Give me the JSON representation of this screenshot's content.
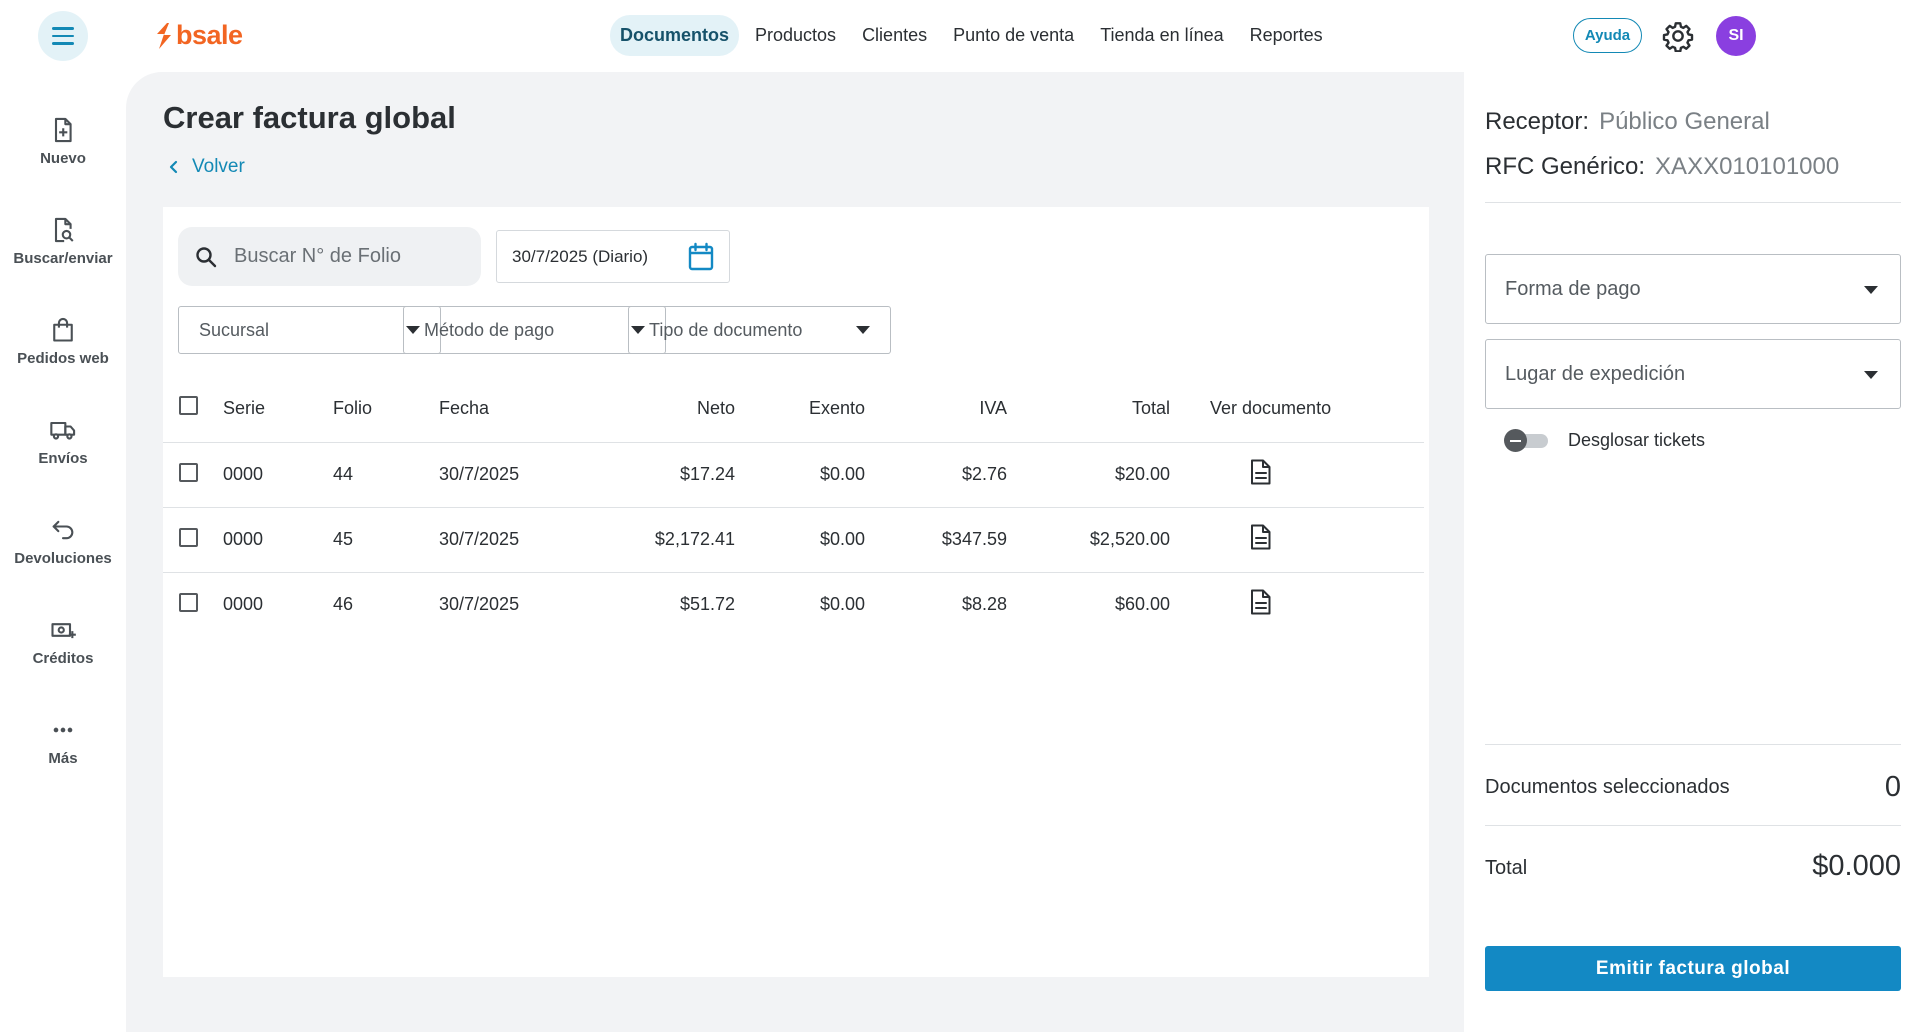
{
  "brand": {
    "name": "bsale",
    "color": "#f26522"
  },
  "nav": {
    "items": [
      {
        "label": "Documentos",
        "active": true
      },
      {
        "label": "Productos"
      },
      {
        "label": "Clientes"
      },
      {
        "label": "Punto de venta"
      },
      {
        "label": "Tienda en línea"
      },
      {
        "label": "Reportes"
      }
    ],
    "help_label": "Ayuda",
    "avatar_initials": "SI"
  },
  "sidebar": {
    "items": [
      {
        "label": "Nuevo",
        "icon": "file-plus-icon"
      },
      {
        "label": "Buscar/enviar",
        "icon": "file-search-icon"
      },
      {
        "label": "Pedidos web",
        "icon": "shopping-bag-icon"
      },
      {
        "label": "Envíos",
        "icon": "truck-icon"
      },
      {
        "label": "Devoluciones",
        "icon": "return-arrow-icon"
      },
      {
        "label": "Créditos",
        "icon": "money-plus-icon"
      },
      {
        "label": "Más",
        "icon": "more-dots-icon"
      }
    ]
  },
  "page": {
    "title": "Crear factura global",
    "back_label": "Volver"
  },
  "filters": {
    "search_placeholder": "Buscar N° de Folio",
    "date_value": "30/7/2025 (Diario)",
    "sucursal": "Sucursal",
    "metodo_pago": "Método de pago",
    "tipo_documento": "Tipo de documento"
  },
  "table": {
    "headers": {
      "serie": "Serie",
      "folio": "Folio",
      "fecha": "Fecha",
      "neto": "Neto",
      "exento": "Exento",
      "iva": "IVA",
      "total": "Total",
      "ver": "Ver documento"
    },
    "rows": [
      {
        "serie": "0000",
        "folio": "44",
        "fecha": "30/7/2025",
        "neto": "$17.24",
        "exento": "$0.00",
        "iva": "$2.76",
        "total": "$20.00",
        "checked": false
      },
      {
        "serie": "0000",
        "folio": "45",
        "fecha": "30/7/2025",
        "neto": "$2,172.41",
        "exento": "$0.00",
        "iva": "$347.59",
        "total": "$2,520.00",
        "checked": false
      },
      {
        "serie": "0000",
        "folio": "46",
        "fecha": "30/7/2025",
        "neto": "$51.72",
        "exento": "$0.00",
        "iva": "$8.28",
        "total": "$60.00",
        "checked": false
      }
    ]
  },
  "right_panel": {
    "receptor_label": "Receptor:",
    "receptor_value": "Público General",
    "rfc_label": "RFC Genérico:",
    "rfc_value": "XAXX010101000",
    "forma_pago": "Forma de pago",
    "lugar_expedicion": "Lugar de expedición",
    "toggle_label": "Desglosar tickets",
    "toggle_on": false,
    "docs_selected_label": "Documentos seleccionados",
    "docs_selected_value": "0",
    "total_label": "Total",
    "total_value": "$0.000",
    "emit_label": "Emitir factura global"
  },
  "colors": {
    "accent": "#1389b5",
    "primary_button": "#1389c4",
    "avatar": "#8a3fe0"
  }
}
